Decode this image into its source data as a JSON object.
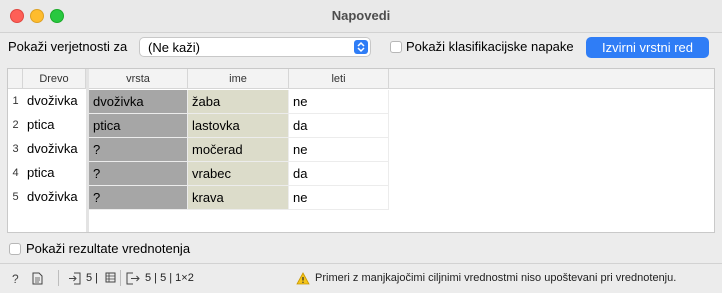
{
  "window": {
    "title": "Napovedi"
  },
  "toolbar": {
    "probabilities_label": "Pokaži verjetnosti za",
    "probabilities_value": "(Ne kaži)",
    "show_errors_label": "Pokaži klasifikacijske napake",
    "show_errors_checked": false,
    "original_order_button": "Izvirni vrstni red"
  },
  "predictions_table": {
    "header": "Drevo",
    "rows": [
      {
        "index": "1",
        "value": "dvoživka"
      },
      {
        "index": "2",
        "value": "ptica"
      },
      {
        "index": "3",
        "value": "dvoživka"
      },
      {
        "index": "4",
        "value": "ptica"
      },
      {
        "index": "5",
        "value": "dvoživka"
      }
    ]
  },
  "data_table": {
    "columns": [
      "vrsta",
      "ime",
      "leti"
    ],
    "rows": [
      [
        "dvoživka",
        "žaba",
        "ne"
      ],
      [
        "ptica",
        "lastovka",
        "da"
      ],
      [
        "?",
        "močerad",
        "ne"
      ],
      [
        "?",
        "vrabec",
        "da"
      ],
      [
        "?",
        "krava",
        "ne"
      ]
    ],
    "column_colors": {
      "class": "#a6a6a6",
      "meta": "#dcdcca"
    }
  },
  "evaluation": {
    "label": "Pokaži rezultate vrednotenja",
    "checked": false
  },
  "statusbar": {
    "input_summary": "5 |",
    "output_summary": "5 | 5 | 1×2",
    "warning": "Primeri z manjkajočimi ciljnimi vrednostmi niso upoštevani pri vrednotenju."
  }
}
